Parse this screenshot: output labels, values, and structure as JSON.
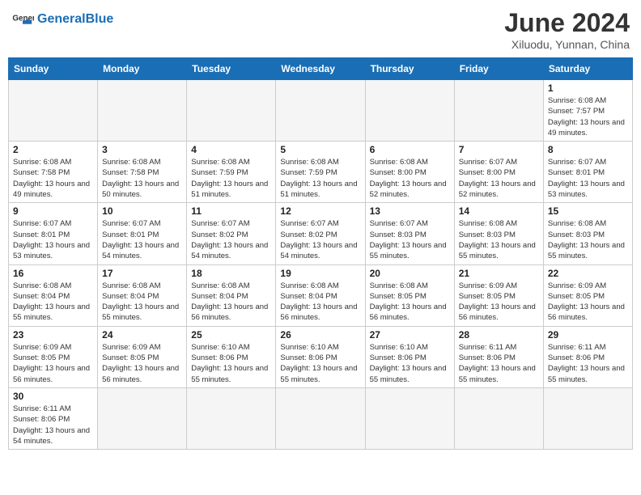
{
  "header": {
    "logo_general": "General",
    "logo_blue": "Blue",
    "month_title": "June 2024",
    "location": "Xiluodu, Yunnan, China"
  },
  "weekdays": [
    "Sunday",
    "Monday",
    "Tuesday",
    "Wednesday",
    "Thursday",
    "Friday",
    "Saturday"
  ],
  "weeks": [
    [
      {
        "day": "",
        "empty": true
      },
      {
        "day": "",
        "empty": true
      },
      {
        "day": "",
        "empty": true
      },
      {
        "day": "",
        "empty": true
      },
      {
        "day": "",
        "empty": true
      },
      {
        "day": "",
        "empty": true
      },
      {
        "day": "1",
        "sunrise": "6:08 AM",
        "sunset": "7:57 PM",
        "daylight": "13 hours and 49 minutes."
      }
    ],
    [
      {
        "day": "2",
        "sunrise": "6:08 AM",
        "sunset": "7:58 PM",
        "daylight": "13 hours and 49 minutes."
      },
      {
        "day": "3",
        "sunrise": "6:08 AM",
        "sunset": "7:58 PM",
        "daylight": "13 hours and 50 minutes."
      },
      {
        "day": "4",
        "sunrise": "6:08 AM",
        "sunset": "7:59 PM",
        "daylight": "13 hours and 51 minutes."
      },
      {
        "day": "5",
        "sunrise": "6:08 AM",
        "sunset": "7:59 PM",
        "daylight": "13 hours and 51 minutes."
      },
      {
        "day": "6",
        "sunrise": "6:08 AM",
        "sunset": "8:00 PM",
        "daylight": "13 hours and 52 minutes."
      },
      {
        "day": "7",
        "sunrise": "6:07 AM",
        "sunset": "8:00 PM",
        "daylight": "13 hours and 52 minutes."
      },
      {
        "day": "8",
        "sunrise": "6:07 AM",
        "sunset": "8:01 PM",
        "daylight": "13 hours and 53 minutes."
      }
    ],
    [
      {
        "day": "9",
        "sunrise": "6:07 AM",
        "sunset": "8:01 PM",
        "daylight": "13 hours and 53 minutes."
      },
      {
        "day": "10",
        "sunrise": "6:07 AM",
        "sunset": "8:01 PM",
        "daylight": "13 hours and 54 minutes."
      },
      {
        "day": "11",
        "sunrise": "6:07 AM",
        "sunset": "8:02 PM",
        "daylight": "13 hours and 54 minutes."
      },
      {
        "day": "12",
        "sunrise": "6:07 AM",
        "sunset": "8:02 PM",
        "daylight": "13 hours and 54 minutes."
      },
      {
        "day": "13",
        "sunrise": "6:07 AM",
        "sunset": "8:03 PM",
        "daylight": "13 hours and 55 minutes."
      },
      {
        "day": "14",
        "sunrise": "6:08 AM",
        "sunset": "8:03 PM",
        "daylight": "13 hours and 55 minutes."
      },
      {
        "day": "15",
        "sunrise": "6:08 AM",
        "sunset": "8:03 PM",
        "daylight": "13 hours and 55 minutes."
      }
    ],
    [
      {
        "day": "16",
        "sunrise": "6:08 AM",
        "sunset": "8:04 PM",
        "daylight": "13 hours and 55 minutes."
      },
      {
        "day": "17",
        "sunrise": "6:08 AM",
        "sunset": "8:04 PM",
        "daylight": "13 hours and 55 minutes."
      },
      {
        "day": "18",
        "sunrise": "6:08 AM",
        "sunset": "8:04 PM",
        "daylight": "13 hours and 56 minutes."
      },
      {
        "day": "19",
        "sunrise": "6:08 AM",
        "sunset": "8:04 PM",
        "daylight": "13 hours and 56 minutes."
      },
      {
        "day": "20",
        "sunrise": "6:08 AM",
        "sunset": "8:05 PM",
        "daylight": "13 hours and 56 minutes."
      },
      {
        "day": "21",
        "sunrise": "6:09 AM",
        "sunset": "8:05 PM",
        "daylight": "13 hours and 56 minutes."
      },
      {
        "day": "22",
        "sunrise": "6:09 AM",
        "sunset": "8:05 PM",
        "daylight": "13 hours and 56 minutes."
      }
    ],
    [
      {
        "day": "23",
        "sunrise": "6:09 AM",
        "sunset": "8:05 PM",
        "daylight": "13 hours and 56 minutes."
      },
      {
        "day": "24",
        "sunrise": "6:09 AM",
        "sunset": "8:05 PM",
        "daylight": "13 hours and 56 minutes."
      },
      {
        "day": "25",
        "sunrise": "6:10 AM",
        "sunset": "8:06 PM",
        "daylight": "13 hours and 55 minutes."
      },
      {
        "day": "26",
        "sunrise": "6:10 AM",
        "sunset": "8:06 PM",
        "daylight": "13 hours and 55 minutes."
      },
      {
        "day": "27",
        "sunrise": "6:10 AM",
        "sunset": "8:06 PM",
        "daylight": "13 hours and 55 minutes."
      },
      {
        "day": "28",
        "sunrise": "6:11 AM",
        "sunset": "8:06 PM",
        "daylight": "13 hours and 55 minutes."
      },
      {
        "day": "29",
        "sunrise": "6:11 AM",
        "sunset": "8:06 PM",
        "daylight": "13 hours and 55 minutes."
      }
    ],
    [
      {
        "day": "30",
        "sunrise": "6:11 AM",
        "sunset": "8:06 PM",
        "daylight": "13 hours and 54 minutes."
      },
      {
        "day": "",
        "empty": true
      },
      {
        "day": "",
        "empty": true
      },
      {
        "day": "",
        "empty": true
      },
      {
        "day": "",
        "empty": true
      },
      {
        "day": "",
        "empty": true
      },
      {
        "day": "",
        "empty": true
      }
    ]
  ],
  "labels": {
    "sunrise": "Sunrise:",
    "sunset": "Sunset:",
    "daylight": "Daylight:"
  }
}
